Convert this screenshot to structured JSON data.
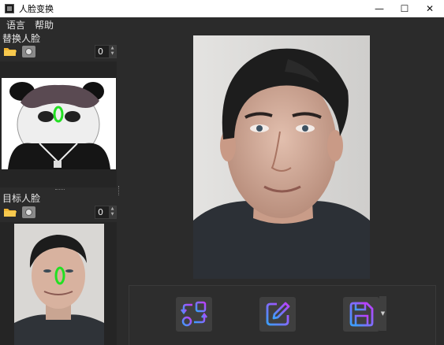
{
  "window": {
    "title": "人脸变换",
    "minimize_glyph": "—",
    "maximize_glyph": "☐",
    "close_glyph": "✕"
  },
  "menu": {
    "items": [
      "语言",
      "帮助"
    ]
  },
  "source_section": {
    "label": "替换人脸",
    "count": "0",
    "open_icon": "folder-icon",
    "camera_icon": "camera-icon"
  },
  "target_section": {
    "label": "目标人脸",
    "count": "0",
    "open_icon": "folder-icon",
    "camera_icon": "camera-icon"
  },
  "actions": [
    {
      "icon": "swap-icon"
    },
    {
      "icon": "edit-icon"
    },
    {
      "icon": "save-icon"
    }
  ],
  "colors": {
    "accent_gradient_start": "#3aa0ff",
    "accent_gradient_end": "#c13cff",
    "face_marker": "#22e022",
    "folder": "#f2b632"
  }
}
